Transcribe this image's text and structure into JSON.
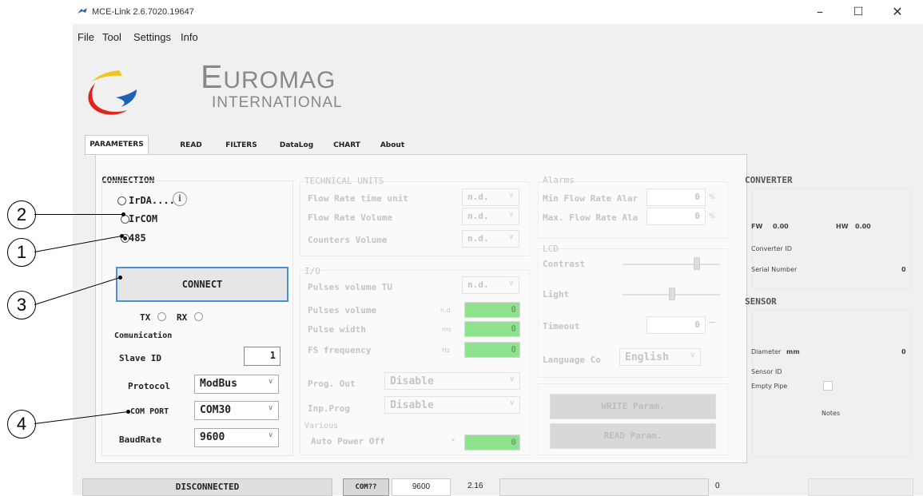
{
  "window": {
    "title": "MCE-Link 2.6.7020.19647",
    "controls": {
      "minimize": "–",
      "maximize": "☐",
      "close": "✕"
    }
  },
  "menu": [
    "File",
    "Tool",
    "Settings",
    "Info"
  ],
  "logo": {
    "title_big": "E",
    "title_rest": "UROMAG",
    "subtitle": "INTERNATIONAL"
  },
  "tabs": [
    "PARAMETERS",
    "READ",
    "FILTERS",
    "DataLog",
    "CHART",
    "About"
  ],
  "connection": {
    "title": "CONNECTION",
    "options": [
      "IrDA....",
      "IrCOM",
      "485"
    ],
    "selected": "485",
    "connect_label": "CONNECT",
    "tx": "TX",
    "rx": "RX",
    "comm_title": "Comunication",
    "slave_id_label": "Slave ID",
    "slave_id": "1",
    "protocol_label": "Protocol",
    "protocol": "ModBus",
    "com_port_label": "COM PORT",
    "com_port": "COM30",
    "baud_label": "BaudRate",
    "baud": "9600"
  },
  "technical": {
    "title": "TECHNICAL UNITS",
    "rows": [
      {
        "label": "Flow Rate time unit",
        "value": "n.d."
      },
      {
        "label": "Flow Rate Volume",
        "value": "n.d."
      },
      {
        "label": "Counters Volume",
        "value": "n.d."
      }
    ]
  },
  "io": {
    "title": "I/O",
    "pulses_tu_label": "Pulses volume TU",
    "pulses_tu": "n.d.",
    "green_rows": [
      {
        "label": "Pulses volume",
        "unit": "n.d.",
        "value": "0"
      },
      {
        "label": "Pulse width",
        "unit": "ms",
        "value": "0"
      },
      {
        "label": "FS frequency",
        "unit": "Hz",
        "value": "0"
      }
    ],
    "prog_out_label": "Prog. Out",
    "prog_out": "Disable",
    "inp_prog_label": "Inp.Prog",
    "inp_prog": "Disable",
    "various_title": "Various",
    "auto_power_label": "Auto Power Off",
    "auto_power_unit": "*",
    "auto_power": "0"
  },
  "alarms": {
    "title": "Alarms",
    "min_label": "Min Flow Rate Alar",
    "min_value": "0",
    "min_unit": "%",
    "max_label": "Max. Flow Rate Ala",
    "max_value": "0",
    "max_unit": "%"
  },
  "lcd": {
    "title": "LCD",
    "contrast_label": "Contrast",
    "contrast_level": 0.75,
    "light_label": "Light",
    "light_level": 0.5,
    "timeout_label": "Timeout",
    "timeout_value": "0",
    "language_label": "Language Co",
    "language": "English"
  },
  "buttons": {
    "write": "WRITE Param.",
    "read": "READ Param."
  },
  "converter": {
    "title": "CONVERTER",
    "fw_label": "FW",
    "fw": "0.00",
    "hw_label": "HW",
    "hw": "0.00",
    "converter_id_label": "Converter ID",
    "serial_label": "Serial Number",
    "serial": "0"
  },
  "sensor": {
    "title": "SENSOR",
    "diameter_label": "Diameter",
    "diameter_unit": "mm",
    "diameter": "0",
    "sensor_id_label": "Sensor ID",
    "empty_pipe_label": "Empty Pipe",
    "notes_label": "Notes"
  },
  "statusbar": {
    "state": "DISCONNECTED",
    "port": "COM??",
    "baud": "9600",
    "version": "2.16",
    "count": "0"
  },
  "callouts": [
    "1",
    "2",
    "3",
    "4"
  ]
}
